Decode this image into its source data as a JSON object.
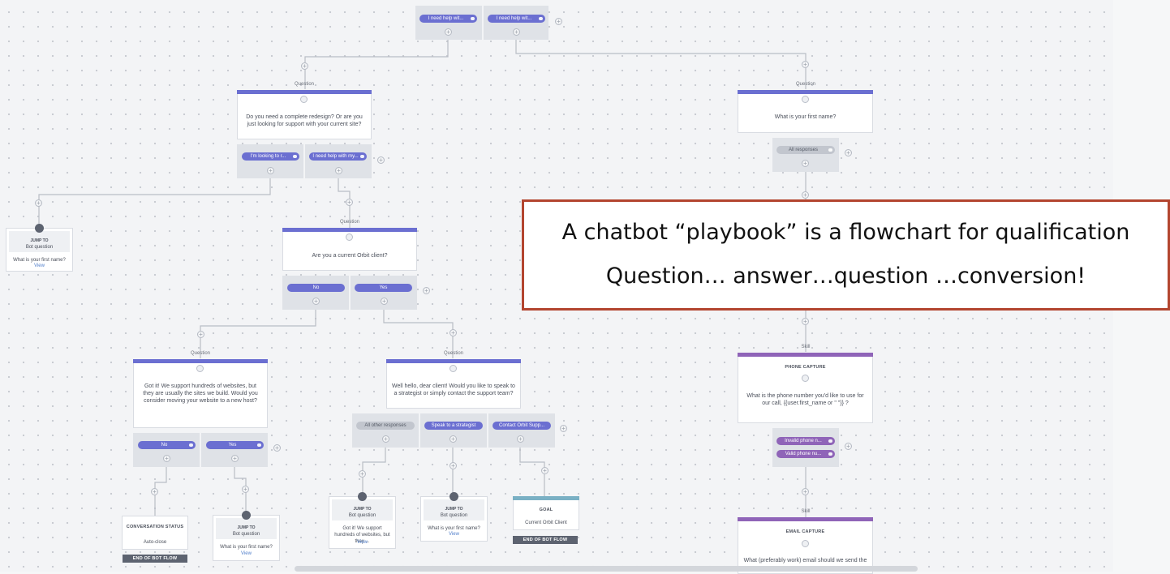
{
  "top_responses": [
    "I need help wit...",
    "I need help wit..."
  ],
  "q1": {
    "label": "Question",
    "text": "Do you need a complete redesign? Or are you just looking for support with your current site?",
    "responses": [
      "I'm looking to r...",
      "I need help with my..."
    ]
  },
  "q_first_name": {
    "label": "Question",
    "text": "What is your first name?",
    "responses": [
      "All responses"
    ]
  },
  "jump_left": {
    "title": "JUMP TO",
    "subtitle": "Bot question",
    "text": "What is your first name?",
    "view": "View"
  },
  "q_orbit": {
    "label": "Question",
    "text": "Are you a current Orbit client?",
    "responses": [
      "No",
      "Yes"
    ]
  },
  "q_move": {
    "label": "Question",
    "text": "Got it! We support hundreds of websites, but they are usually the sites we build. Would you consider moving your website to a new host?",
    "responses": [
      "No",
      "Yes"
    ]
  },
  "q_hello": {
    "label": "Question",
    "text": "Well hello, dear client! Would you like to speak to a strategist or simply contact the support team?",
    "responses": [
      "All other responses",
      "Speak to a strategist",
      "Contact Orbit Supp..."
    ]
  },
  "conv_status": {
    "title": "CONVERSATION STATUS",
    "value": "Auto-close",
    "end": "END OF BOT FLOW"
  },
  "jump_yes": {
    "title": "JUMP TO",
    "subtitle": "Bot question",
    "text": "What is your first name?",
    "view": "View"
  },
  "jump_other": {
    "title": "JUMP TO",
    "subtitle": "Bot question",
    "text": "Got it! We support hundreds of websites, but they ...",
    "view": "View"
  },
  "jump_strategist": {
    "title": "JUMP TO",
    "subtitle": "Bot question",
    "text": "What is your first name?",
    "view": "View"
  },
  "goal": {
    "title": "GOAL",
    "value": "Current Orbit Client",
    "end": "END OF BOT FLOW"
  },
  "skill_phone": {
    "label": "Skill",
    "title": "PHONE CAPTURE",
    "text": "What is the phone number you'd like to use for our call, {{user.first_name or \" \"}} ?",
    "responses": [
      "Invalid phone n...",
      "Valid phone nu..."
    ]
  },
  "skill_email": {
    "label": "Skill",
    "title": "EMAIL CAPTURE",
    "text": "What (preferably work) email should we send the"
  },
  "callout": {
    "line1": "A chatbot “playbook” is a flowchart for qualification",
    "line2": "Question… answer…question …conversion!"
  },
  "colors": {
    "question_bar": "#6b6fd1",
    "skill_bar": "#8f64b8",
    "goal_bar": "#7ab0c4",
    "callout_border": "#b3452f"
  }
}
